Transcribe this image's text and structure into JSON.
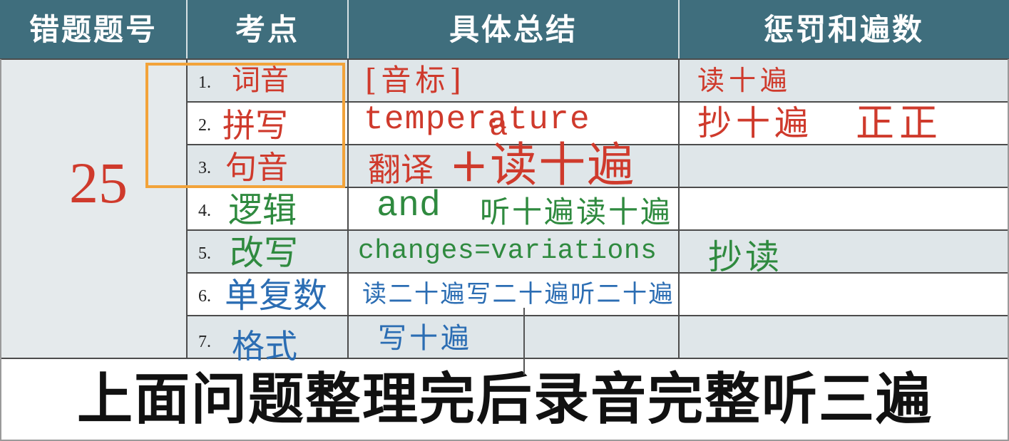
{
  "colors": {
    "header_bg": "#3f6e7d",
    "red": "#cf3a2c",
    "green": "#2f8a3f",
    "blue": "#2b6db3",
    "highlight_box": "#f2a33a"
  },
  "header": {
    "col1": "错题题号",
    "col2": "考点",
    "col3": "具体总结",
    "col4": "惩罚和遍数"
  },
  "question_number": "25",
  "rows": [
    {
      "num": "1.",
      "label": "词音",
      "summary": "[音标]",
      "penalty": "读十遍"
    },
    {
      "num": "2.",
      "label": "拼写",
      "summary": "temperature",
      "summary_note": "a",
      "penalty": "抄十遍",
      "penalty_tally": "正正"
    },
    {
      "num": "3.",
      "label": "句音",
      "summary": "翻译",
      "summary_extra": "+读十遍"
    },
    {
      "num": "4.",
      "label": "逻辑",
      "summary": "and",
      "summary_extra": "听十遍读十遍"
    },
    {
      "num": "5.",
      "label": "改写",
      "summary": "changes=variations",
      "penalty": "抄读"
    },
    {
      "num": "6.",
      "label": "单复数",
      "summary": "读二十遍写二十遍听二十遍"
    },
    {
      "num": "7.",
      "label": "格式",
      "summary": "写十遍"
    }
  ],
  "footer": "上面问题整理完后录音完整听三遍"
}
